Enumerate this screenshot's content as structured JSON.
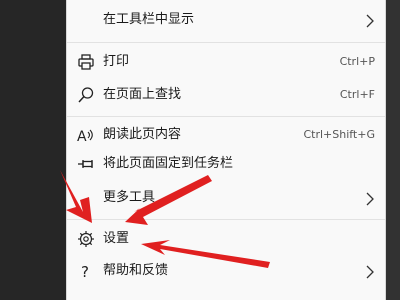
{
  "menu": {
    "items": [
      {
        "label": "在工具栏中显示",
        "shortcut": "",
        "icon": "none",
        "submenu": true
      },
      {
        "label": "打印",
        "shortcut": "Ctrl+P",
        "icon": "printer-icon",
        "submenu": false
      },
      {
        "label": "在页面上查找",
        "shortcut": "Ctrl+F",
        "icon": "search-icon",
        "submenu": false
      },
      {
        "label": "朗读此页内容",
        "shortcut": "Ctrl+Shift+G",
        "icon": "read-aloud-icon",
        "submenu": false
      },
      {
        "label": "将此页面固定到任务栏",
        "shortcut": "",
        "icon": "pin-icon",
        "submenu": false
      },
      {
        "label": "更多工具",
        "shortcut": "",
        "icon": "none",
        "submenu": true
      },
      {
        "label": "设置",
        "shortcut": "",
        "icon": "gear-icon",
        "submenu": false
      },
      {
        "label": "帮助和反馈",
        "shortcut": "",
        "icon": "help-icon",
        "submenu": true
      }
    ]
  },
  "annotations": {
    "arrow_color": "#e02020",
    "arrow_count": 3,
    "target": "设置"
  }
}
